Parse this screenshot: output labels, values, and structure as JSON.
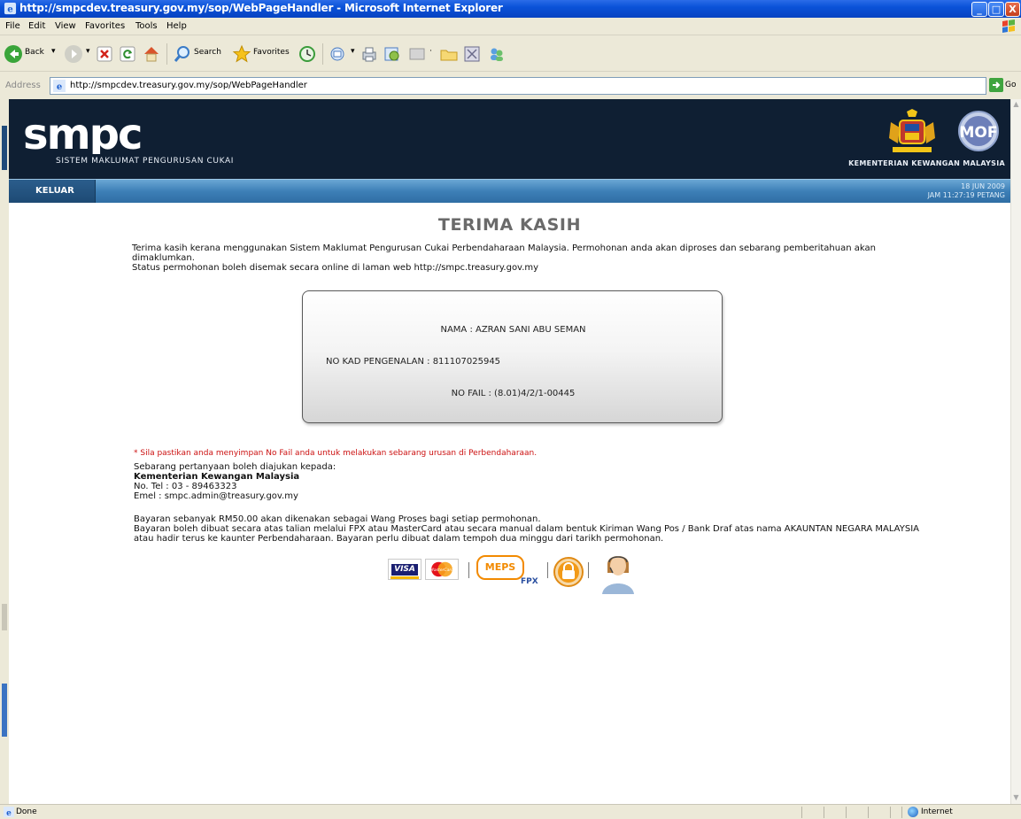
{
  "window": {
    "title": "http://smpcdev.treasury.gov.my/sop/WebPageHandler - Microsoft Internet Explorer",
    "controls": {
      "minimize": "_",
      "maximize": "□",
      "close": "X"
    }
  },
  "menu": [
    "File",
    "Edit",
    "View",
    "Favorites",
    "Tools",
    "Help"
  ],
  "toolbar": {
    "back": "Back",
    "search": "Search",
    "favorites": "Favorites"
  },
  "address": {
    "label": "Address",
    "url": "http://smpcdev.treasury.gov.my/sop/WebPageHandler",
    "go": "Go"
  },
  "header": {
    "logo_text": "smpc",
    "subtitle": "SISTEM MAKLUMAT PENGURUSAN CUKAI",
    "ministry": "KEMENTERIAN KEWANGAN MALAYSIA",
    "mof": "MOF"
  },
  "nav": {
    "keluar": "KELUAR",
    "date": "18 JUN 2009",
    "time": "JAM 11:27:19 PETANG"
  },
  "content": {
    "title": "TERIMA KASIH",
    "intro_line1": "Terima kasih kerana menggunakan Sistem Maklumat Pengurusan Cukai Perbendaharaan Malaysia. Permohonan anda akan diproses dan sebarang pemberitahuan akan dimaklumkan.",
    "intro_line2": "Status permohonan boleh disemak secara online di laman web http://smpc.treasury.gov.my",
    "nama": "NAMA : AZRAN SANI ABU SEMAN",
    "no_kad": "NO KAD PENGENALAN : 811107025945",
    "no_fail": "NO FAIL : (8.01)4/2/1-00445",
    "warning": "* Sila pastikan anda menyimpan No Fail anda untuk melakukan sebarang urusan di Perbendaharaan.",
    "contact_intro": "Sebarang pertanyaan boleh diajukan kepada:",
    "contact_org": "Kementerian Kewangan Malaysia",
    "contact_tel": "No. Tel : 03 - 89463323",
    "contact_email": "Emel : smpc.admin@treasury.gov.my",
    "payment_line1": "Bayaran sebanyak RM50.00 akan dikenakan sebagai Wang Proses bagi setiap permohonan.",
    "payment_line2": "Bayaran boleh dibuat secara atas talian melalui FPX atau MasterCard atau secara manual dalam bentuk Kiriman Wang Pos / Bank Draf atas nama AKAUNTAN NEGARA MALAYSIA atau hadir terus ke kaunter Perbendaharaan. Bayaran perlu dibuat dalam tempoh dua minggu dari tarikh permohonan."
  },
  "payment_logos": {
    "visa": "VISA",
    "mastercard": "MasterCard",
    "meps": "MEPS",
    "fpx": "FPX"
  },
  "status": {
    "left": "Done",
    "zone": "Internet"
  },
  "colors": {
    "titlebar": "#0a52d8",
    "header_bg": "#0f1f33",
    "nav": "#3d7fb7",
    "warning": "#cc1111"
  }
}
